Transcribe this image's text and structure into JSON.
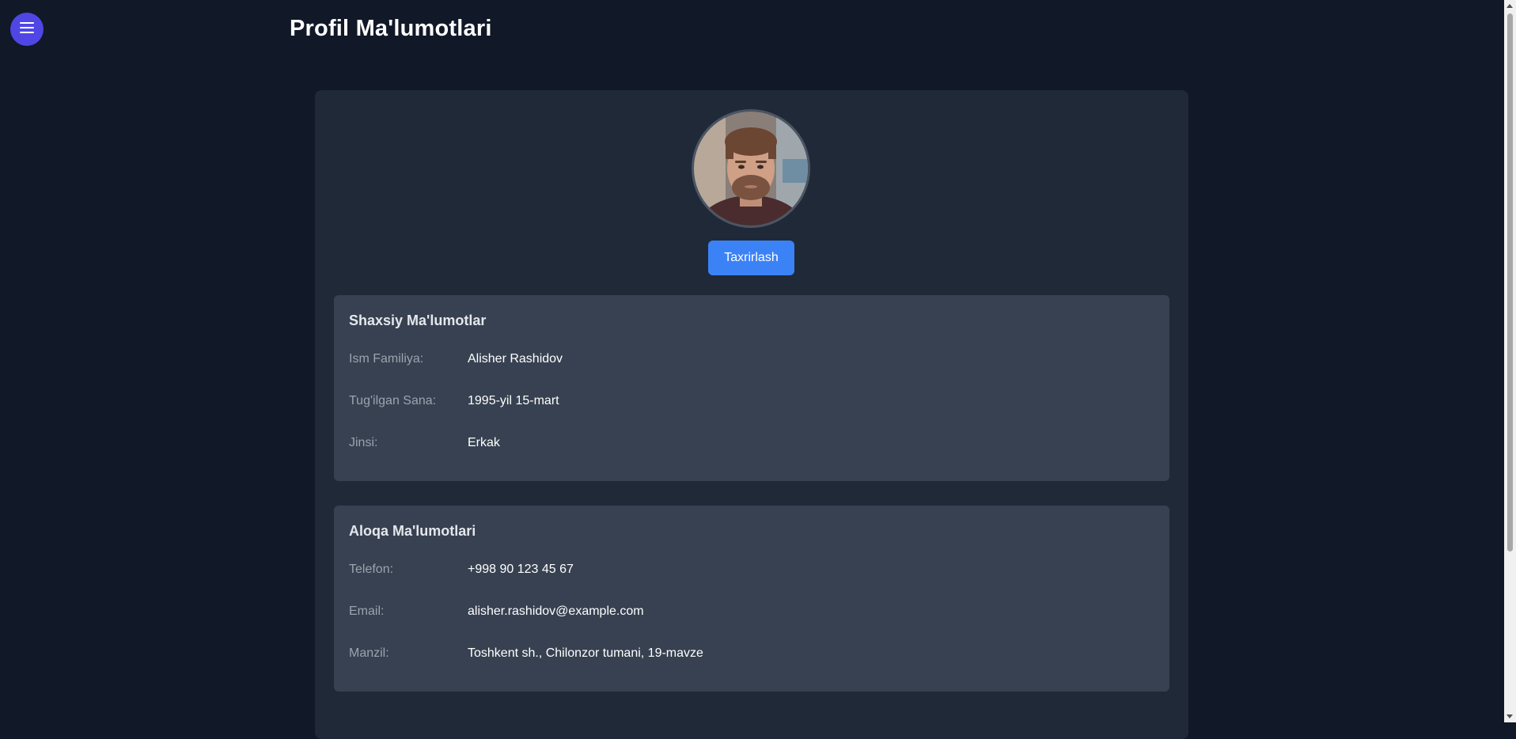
{
  "header": {
    "title": "Profil Ma'lumotlari",
    "menu_icon": "hamburger-menu-icon"
  },
  "profile": {
    "avatar_alt": "profile-photo",
    "edit_label": "Taxrirlash"
  },
  "personal": {
    "title": "Shaxsiy Ma'lumotlar",
    "rows": [
      {
        "label": "Ism Familiya:",
        "value": "Alisher Rashidov"
      },
      {
        "label": "Tug'ilgan Sana:",
        "value": "1995-yil 15-mart"
      },
      {
        "label": "Jinsi:",
        "value": "Erkak"
      }
    ]
  },
  "contact": {
    "title": "Aloqa Ma'lumotlari",
    "rows": [
      {
        "label": "Telefon:",
        "value": "+998 90 123 45 67"
      },
      {
        "label": "Email:",
        "value": "alisher.rashidov@example.com"
      },
      {
        "label": "Manzil:",
        "value": "Toshkent sh., Chilonzor tumani, 19-mavze"
      }
    ]
  },
  "colors": {
    "background": "#111827",
    "card": "#1f2937",
    "section": "#374151",
    "menu_button": "#4f46e5",
    "edit_button": "#3b82f6"
  }
}
